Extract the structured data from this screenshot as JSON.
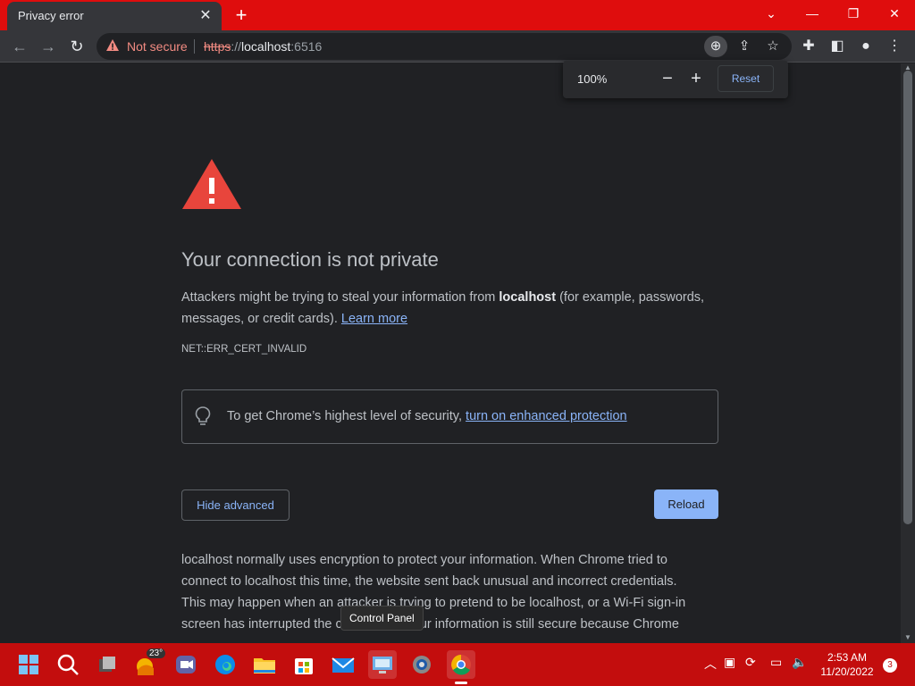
{
  "tab": {
    "title": "Privacy error"
  },
  "address": {
    "security_label": "Not secure",
    "scheme": "https",
    "separator": "://",
    "host": "localhost",
    "port": ":6516"
  },
  "zoom": {
    "level": "100%",
    "reset_label": "Reset"
  },
  "page": {
    "heading": "Your connection is not private",
    "para_prefix": "Attackers might be trying to steal your information from ",
    "para_host": "localhost",
    "para_suffix": " (for example, passwords, messages, or credit cards). ",
    "learn_more": "Learn more",
    "error_code": "NET::ERR_CERT_INVALID",
    "tip_text": "To get Chrome’s highest level of security, ",
    "tip_link": "turn on enhanced protection",
    "hide_advanced": "Hide advanced",
    "reload": "Reload",
    "details_line1": "localhost normally uses encryption to protect your information. When Chrome tried to",
    "details_line2": "connect to localhost this time, the website sent back unusual and incorrect credentials.",
    "details_line3": "This may happen when an attacker is trying to pretend to be localhost, or a Wi-Fi sign-in",
    "details_line4": "screen has interrupted the connection. Your information is still secure because Chrome"
  },
  "tooltip": {
    "text": "Control Panel"
  },
  "taskbar": {
    "weather_temp": "23°",
    "time": "2:53 AM",
    "date": "11/20/2022",
    "notification_count": "3"
  },
  "colors": {
    "titlebar": "#df0d0d",
    "taskbar": "#c30d0d",
    "link": "#8ab4f8",
    "warning": "#f28b82",
    "error_icon": "#e8453c"
  }
}
